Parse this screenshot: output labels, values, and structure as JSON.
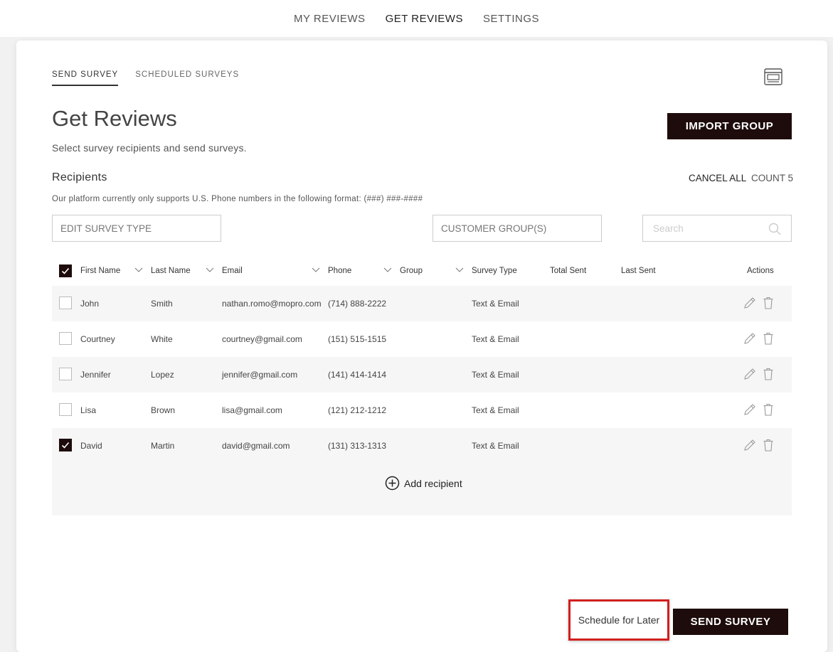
{
  "topnav": {
    "items": [
      "MY REVIEWS",
      "GET REVIEWS",
      "SETTINGS"
    ],
    "active": "GET REVIEWS"
  },
  "subtabs": [
    "SEND SURVEY",
    "SCHEDULED SURVEYS"
  ],
  "page": {
    "title": "Get Reviews",
    "subtitle": "Select survey recipients and send surveys.",
    "import_label": "IMPORT GROUP"
  },
  "recipients": {
    "title": "Recipients",
    "cancel_all": "CANCEL ALL",
    "count": "COUNT 5",
    "notice": "Our platform currently only supports U.S. Phone numbers in the following format: (###) ###-####"
  },
  "filters": {
    "survey_type": "EDIT SURVEY TYPE",
    "customer_group": "CUSTOMER GROUP(S)",
    "search_placeholder": "Search"
  },
  "table": {
    "headers": [
      "First Name",
      "Last Name",
      "Email",
      "Phone",
      "Group",
      "Survey Type",
      "Total Sent",
      "Last Sent",
      "Actions"
    ],
    "rows": [
      {
        "first": "John",
        "last": "Smith",
        "email": "nathan.romo@mopro.com",
        "phone": "(714) 888-2222",
        "group": "",
        "survey_type": "Text & Email",
        "total_sent": "",
        "last_sent": "",
        "checked": false
      },
      {
        "first": "Courtney",
        "last": "White",
        "email": "courtney@gmail.com",
        "phone": "(151) 515-1515",
        "group": "",
        "survey_type": "Text & Email",
        "total_sent": "",
        "last_sent": "",
        "checked": false
      },
      {
        "first": "Jennifer",
        "last": "Lopez",
        "email": "jennifer@gmail.com",
        "phone": "(141) 414-1414",
        "group": "",
        "survey_type": "Text & Email",
        "total_sent": "",
        "last_sent": "",
        "checked": false
      },
      {
        "first": "Lisa",
        "last": "Brown",
        "email": "lisa@gmail.com",
        "phone": "(121) 212-1212",
        "group": "",
        "survey_type": "Text & Email",
        "total_sent": "",
        "last_sent": "",
        "checked": false
      },
      {
        "first": "David",
        "last": "Martin",
        "email": "david@gmail.com",
        "phone": "(131) 313-1313",
        "group": "",
        "survey_type": "Text & Email",
        "total_sent": "",
        "last_sent": "",
        "checked": true
      }
    ],
    "add_recipient": "Add recipient"
  },
  "footer": {
    "schedule_label": "Schedule for Later",
    "send_label": "SEND SURVEY"
  },
  "colors": {
    "dark_button": "#1e0c0c",
    "highlight_border": "#d21f1f"
  }
}
